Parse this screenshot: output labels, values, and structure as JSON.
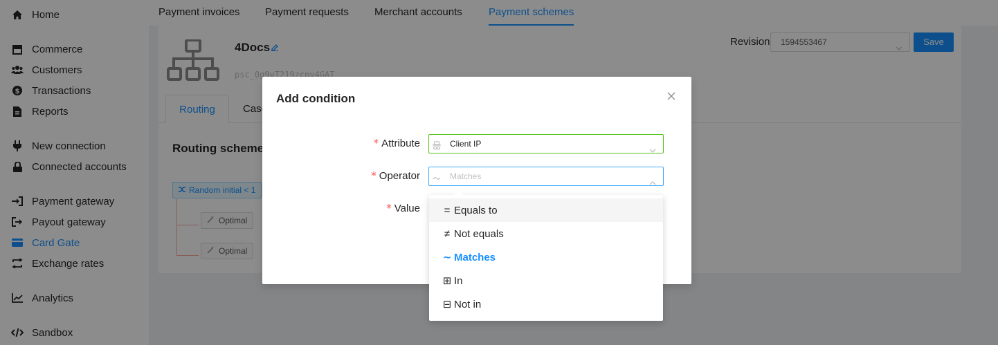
{
  "sidebar": {
    "items": [
      {
        "label": "Home",
        "icon": "home-icon"
      },
      {
        "label": "Commerce",
        "icon": "storefront-icon"
      },
      {
        "label": "Customers",
        "icon": "users-icon"
      },
      {
        "label": "Transactions",
        "icon": "dollar-icon"
      },
      {
        "label": "Reports",
        "icon": "file-icon"
      },
      {
        "label": "New connection",
        "icon": "plug-icon"
      },
      {
        "label": "Connected accounts",
        "icon": "lock-icon"
      },
      {
        "label": "Payment gateway",
        "icon": "sign-in-icon"
      },
      {
        "label": "Payout gateway",
        "icon": "sign-out-icon"
      },
      {
        "label": "Card Gate",
        "icon": "credit-card-icon"
      },
      {
        "label": "Exchange rates",
        "icon": "exchange-icon"
      },
      {
        "label": "Analytics",
        "icon": "chart-line-icon"
      },
      {
        "label": "Sandbox",
        "icon": "code-icon"
      }
    ],
    "active_color": "#1890ff"
  },
  "top_tabs": [
    "Payment invoices",
    "Payment requests",
    "Merchant accounts",
    "Payment schemes"
  ],
  "scheme": {
    "title": "4Docs",
    "id": "psc_0g9vT219zcpv4GAT",
    "revision_label": "Revision",
    "revision_value": "1594553467",
    "save_label": "Save",
    "tabs": [
      "Routing",
      "Casc"
    ],
    "routing_title": "Routing scheme",
    "random_tag": "Random initial < 1",
    "optimal_label": "Optimal"
  },
  "modal": {
    "title": "Add condition",
    "attribute_label": "Attribute",
    "attribute_value": "Client IP",
    "operator_label": "Operator",
    "operator_placeholder": "Matches",
    "value_label": "Value",
    "required_mark": "*"
  },
  "operator_options": [
    {
      "label": "Equals to",
      "symbol": "="
    },
    {
      "label": "Not equals",
      "symbol": "≠"
    },
    {
      "label": "Matches",
      "symbol": "∼"
    },
    {
      "label": "In",
      "symbol": "⊞"
    },
    {
      "label": "Not in",
      "symbol": "⊟"
    }
  ],
  "colors": {
    "primary": "#1890ff",
    "success_border": "#52c41a",
    "required": "#ff4d4f"
  }
}
